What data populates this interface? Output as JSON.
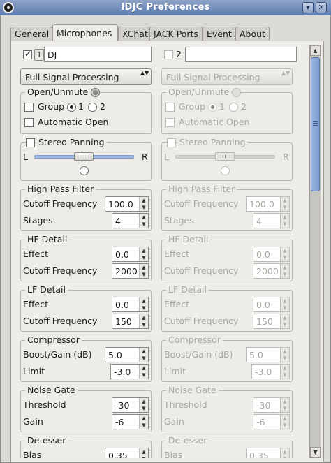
{
  "window": {
    "title": "IDJC Preferences",
    "minimize_glyph": "▾",
    "close_glyph": "✕",
    "icon": "idjc-app-icon"
  },
  "tabs": [
    {
      "label": "General",
      "active": false
    },
    {
      "label": "Microphones",
      "active": true
    },
    {
      "label": "XChat",
      "active": false
    },
    {
      "label": "JACK Ports",
      "active": false
    },
    {
      "label": "Event",
      "active": false
    },
    {
      "label": "About",
      "active": false
    }
  ],
  "scrollbar": {
    "up_glyph": "▲",
    "down_glyph": "▼"
  },
  "channels": [
    {
      "enabled": true,
      "index": "1",
      "name": "DJ",
      "processing_mode": "Full Signal Processing",
      "combo_arrows": "▲▼",
      "open_unmute": {
        "title": "Open/Unmute",
        "group_label": "Group",
        "group_selected": "1",
        "group_options": [
          "1",
          "2"
        ],
        "automatic_open_label": "Automatic Open",
        "automatic_open": false
      },
      "stereo_panning": {
        "title": "Stereo Panning",
        "enabled": false,
        "left_label": "L",
        "right_label": "R",
        "position": 0.5
      },
      "high_pass": {
        "title": "High Pass Filter",
        "cutoff_label": "Cutoff Frequency",
        "cutoff": "100.0",
        "stages_label": "Stages",
        "stages": "4"
      },
      "hf_detail": {
        "title": "HF Detail",
        "effect_label": "Effect",
        "effect": "0.0",
        "cutoff_label": "Cutoff Frequency",
        "cutoff": "2000"
      },
      "lf_detail": {
        "title": "LF Detail",
        "effect_label": "Effect",
        "effect": "0.0",
        "cutoff_label": "Cutoff Frequency",
        "cutoff": "150"
      },
      "compressor": {
        "title": "Compressor",
        "boost_label": "Boost/Gain (dB)",
        "boost": "5.0",
        "limit_label": "Limit",
        "limit": "-3.0"
      },
      "noise_gate": {
        "title": "Noise Gate",
        "threshold_label": "Threshold",
        "threshold": "-30",
        "gain_label": "Gain",
        "gain": "-6"
      },
      "de_esser": {
        "title": "De-esser",
        "bias_label": "Bias",
        "bias": "0.35"
      }
    },
    {
      "enabled": false,
      "index": "2",
      "name": "",
      "processing_mode": "Full Signal Processing",
      "combo_arrows": "▲▼",
      "open_unmute": {
        "title": "Open/Unmute",
        "group_label": "Group",
        "group_selected": "1",
        "group_options": [
          "1",
          "2"
        ],
        "automatic_open_label": "Automatic Open",
        "automatic_open": false
      },
      "stereo_panning": {
        "title": "Stereo Panning",
        "enabled": false,
        "left_label": "L",
        "right_label": "R",
        "position": 0.5
      },
      "high_pass": {
        "title": "High Pass Filter",
        "cutoff_label": "Cutoff Frequency",
        "cutoff": "100.0",
        "stages_label": "Stages",
        "stages": "4"
      },
      "hf_detail": {
        "title": "HF Detail",
        "effect_label": "Effect",
        "effect": "0.0",
        "cutoff_label": "Cutoff Frequency",
        "cutoff": "2000"
      },
      "lf_detail": {
        "title": "LF Detail",
        "effect_label": "Effect",
        "effect": "0.0",
        "cutoff_label": "Cutoff Frequency",
        "cutoff": "150"
      },
      "compressor": {
        "title": "Compressor",
        "boost_label": "Boost/Gain (dB)",
        "boost": "5.0",
        "limit_label": "Limit",
        "limit": "-3.0"
      },
      "noise_gate": {
        "title": "Noise Gate",
        "threshold_label": "Threshold",
        "threshold": "-30",
        "gain_label": "Gain",
        "gain": "-6"
      },
      "de_esser": {
        "title": "De-esser",
        "bias_label": "Bias",
        "bias": "0.35"
      }
    }
  ]
}
